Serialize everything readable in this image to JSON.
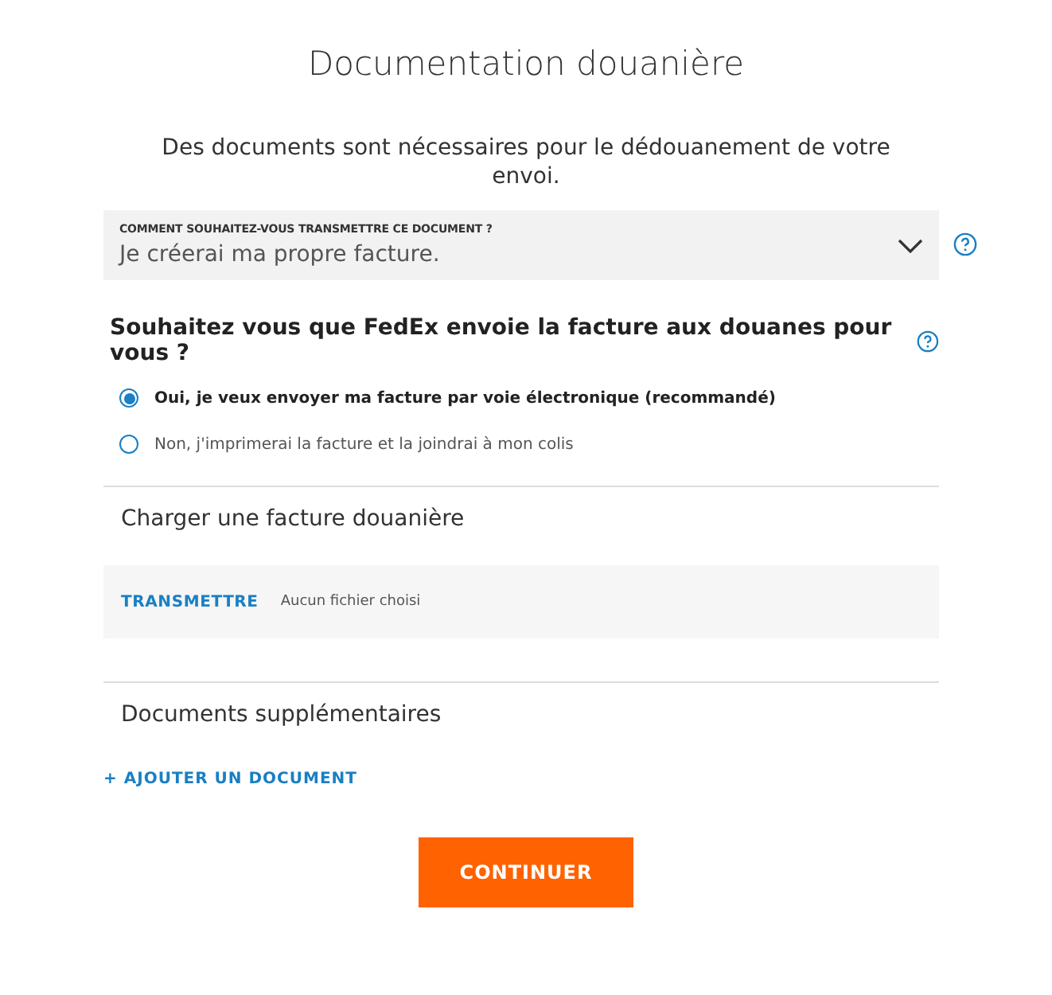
{
  "title": "Documentation douanière",
  "description": "Des documents sont nécessaires pour le dédouanement de votre envoi.",
  "select": {
    "label": "COMMENT SOUHAITEZ-VOUS TRANSMETTRE CE DOCUMENT ?",
    "value": "Je créerai ma propre facture."
  },
  "question": "Souhaitez vous que FedEx envoie la facture aux douanes pour vous ?",
  "options": [
    {
      "label": "Oui, je veux envoyer ma facture par voie électronique (recommandé)",
      "selected": true
    },
    {
      "label": "Non, j'imprimerai la facture et la joindrai à mon colis",
      "selected": false
    }
  ],
  "upload": {
    "heading": "Charger une facture douanière",
    "button": "TRANSMETTRE",
    "status": "Aucun fichier choisi"
  },
  "additional": {
    "heading": "Documents supplémentaires",
    "add_link": "+ AJOUTER UN DOCUMENT"
  },
  "submit": "CONTINUER"
}
